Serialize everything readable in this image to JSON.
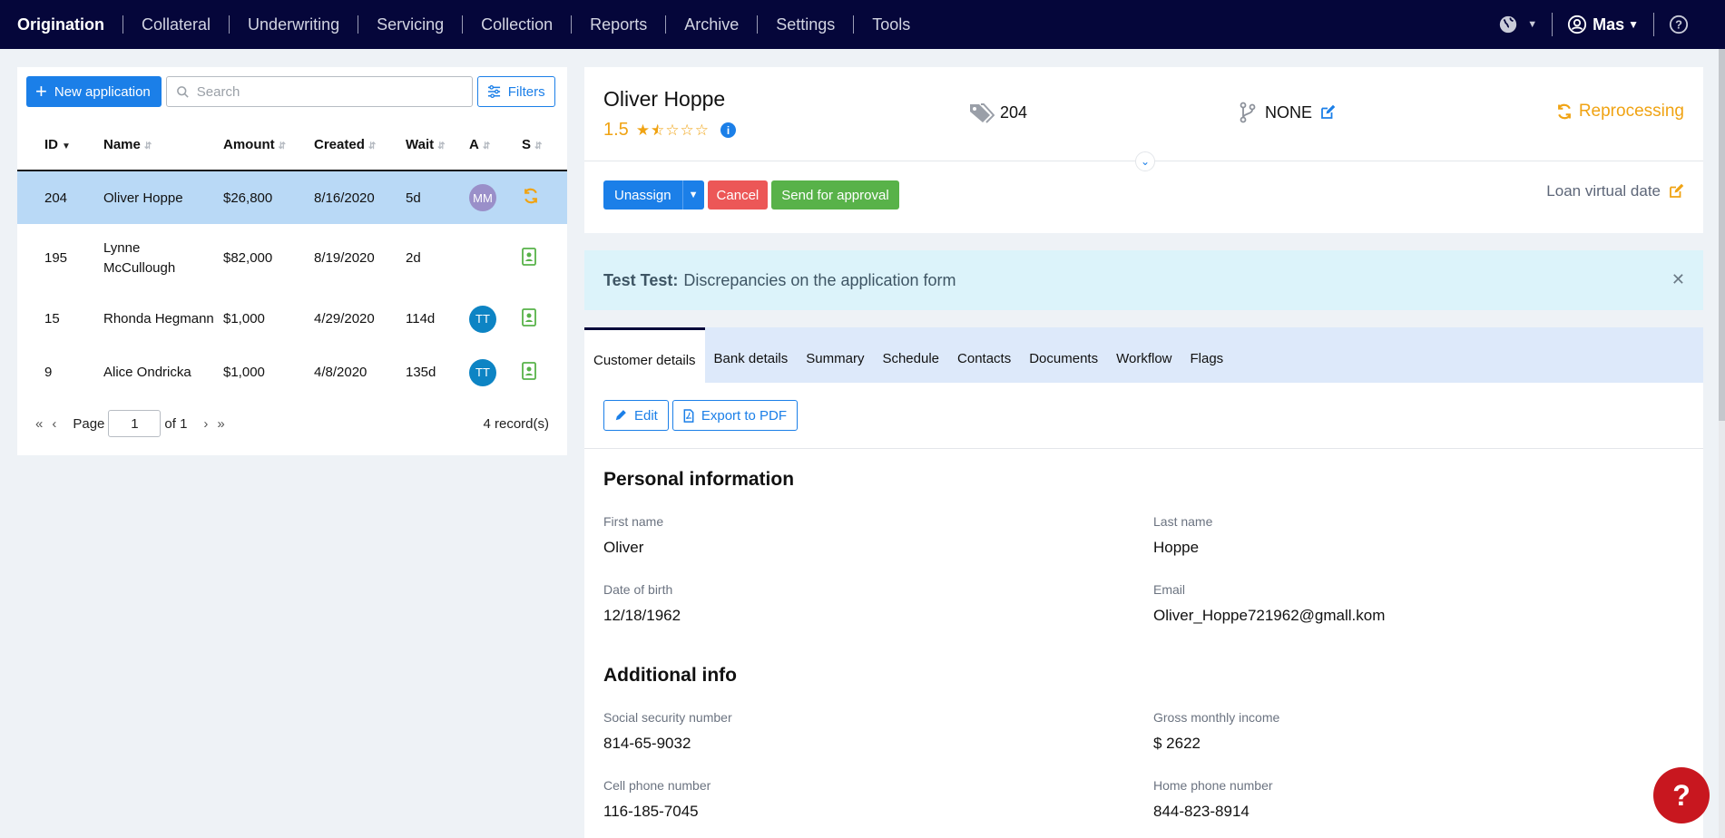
{
  "nav": {
    "items": [
      "Origination",
      "Collateral",
      "Underwriting",
      "Servicing",
      "Collection",
      "Reports",
      "Archive",
      "Settings",
      "Tools"
    ],
    "user": "Mas"
  },
  "list": {
    "new_button": "New application",
    "search_placeholder": "Search",
    "filters_button": "Filters",
    "columns": [
      "ID",
      "Name",
      "Amount",
      "Created",
      "Wait",
      "A",
      "S"
    ],
    "rows": [
      {
        "id": "204",
        "name": "Oliver Hoppe",
        "amount": "$26,800",
        "created": "8/16/2020",
        "wait": "5d",
        "assignee": "MM",
        "status_icon": "refresh-icon"
      },
      {
        "id": "195",
        "name": "Lynne McCullough",
        "amount": "$82,000",
        "created": "8/19/2020",
        "wait": "2d",
        "assignee": "",
        "status_icon": "contact-card-icon"
      },
      {
        "id": "15",
        "name": "Rhonda Hegmann",
        "amount": "$1,000",
        "created": "4/29/2020",
        "wait": "114d",
        "assignee": "TT",
        "status_icon": "contact-card-icon"
      },
      {
        "id": "9",
        "name": "Alice Ondricka",
        "amount": "$1,000",
        "created": "4/8/2020",
        "wait": "135d",
        "assignee": "TT",
        "status_icon": "contact-card-icon"
      }
    ],
    "pager": {
      "page_label": "Page",
      "page": "1",
      "of_label": "of 1",
      "records": "4 record(s)"
    }
  },
  "header": {
    "name": "Oliver Hoppe",
    "rating": "1.5",
    "rating_value": 1.5,
    "rating_max": 5,
    "tag_count": "204",
    "branch": "NONE",
    "status": "Reprocessing",
    "unassign": "Unassign",
    "cancel": "Cancel",
    "send_approval": "Send for approval",
    "loan_virtual_date": "Loan virtual date"
  },
  "alert": {
    "author": "Test Test:",
    "message": "Discrepancies on the application form"
  },
  "tabs": [
    "Customer details",
    "Bank details",
    "Summary",
    "Schedule",
    "Contacts",
    "Documents",
    "Workflow",
    "Flags"
  ],
  "actions": {
    "edit": "Edit",
    "export": "Export to PDF"
  },
  "personal": {
    "title": "Personal information",
    "first_name_label": "First name",
    "first_name": "Oliver",
    "last_name_label": "Last name",
    "last_name": "Hoppe",
    "dob_label": "Date of birth",
    "dob": "12/18/1962",
    "email_label": "Email",
    "email": "Oliver_Hoppe721962@gmall.kom"
  },
  "additional": {
    "title": "Additional info",
    "ssn_label": "Social security number",
    "ssn": "814-65-9032",
    "income_label": "Gross monthly income",
    "income": "$ 2622",
    "cell_label": "Cell phone number",
    "cell": "116-185-7045",
    "home_label": "Home phone number",
    "home": "844-823-8914"
  },
  "colors": {
    "nav_bg": "#05063a",
    "primary": "#1b7fe8",
    "warning": "#f0a313",
    "danger": "#ec5757",
    "success": "#58b249",
    "selected_row": "#b9d9f6",
    "help": "#c8171f"
  }
}
